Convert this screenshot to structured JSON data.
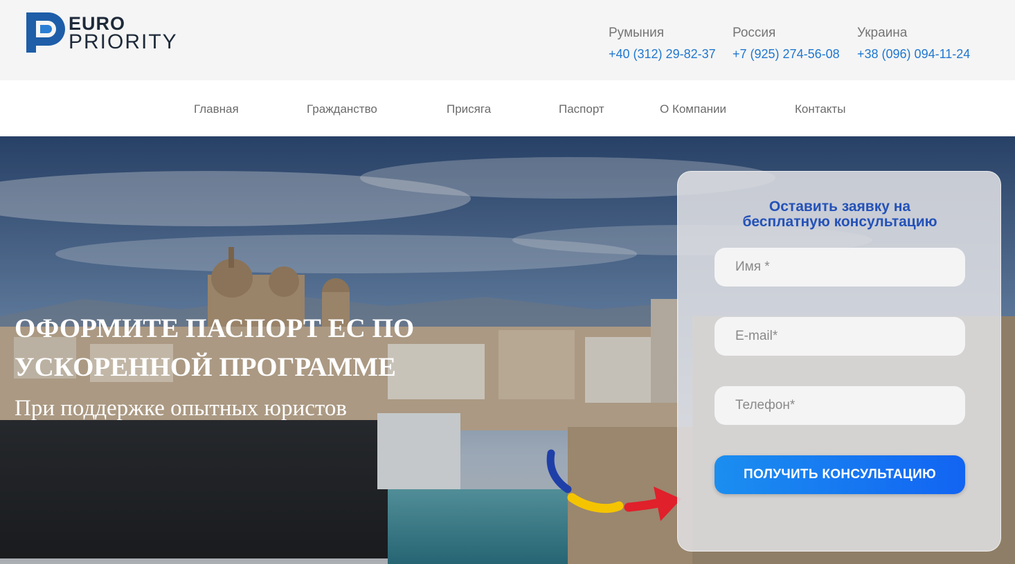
{
  "brand": {
    "euro": "EURO",
    "priority": "PRIORITY",
    "color": "#1e5ea8"
  },
  "contacts": [
    {
      "country": "Румыния",
      "phone": "+40 (312) 29-82-37"
    },
    {
      "country": "Россия",
      "phone": "+7 (925) 274-56-08"
    },
    {
      "country": "Украина",
      "phone": "+38 (096) 094-11-24"
    }
  ],
  "nav": {
    "items": [
      "Главная",
      "Гражданство",
      "Присяга",
      "Паспорт",
      "О Компании",
      "Контакты"
    ]
  },
  "hero": {
    "title_line1": "ОФОРМИТЕ ПАСПОРТ ЕС ПО",
    "title_line2": "УСКОРЕННОЙ ПРОГРАММЕ",
    "subtitle": "При поддержке опытных юристов"
  },
  "form": {
    "title_line1": "Оставить заявку на",
    "title_line2": "бесплатную консультацию",
    "name_placeholder": "Имя *",
    "email_placeholder": "E-mail*",
    "phone_placeholder": "Телефон*",
    "submit_label": "ПОЛУЧИТЬ КОНСУЛЬТАЦИЮ"
  },
  "colors": {
    "accent_blue": "#1f77d0",
    "form_title": "#2452b8",
    "button_start": "#1b8ef0",
    "button_end": "#1264f2",
    "arrow_red": "#e0202a",
    "stroke_yellow": "#f5c400",
    "stroke_blue": "#1f3fa8"
  }
}
